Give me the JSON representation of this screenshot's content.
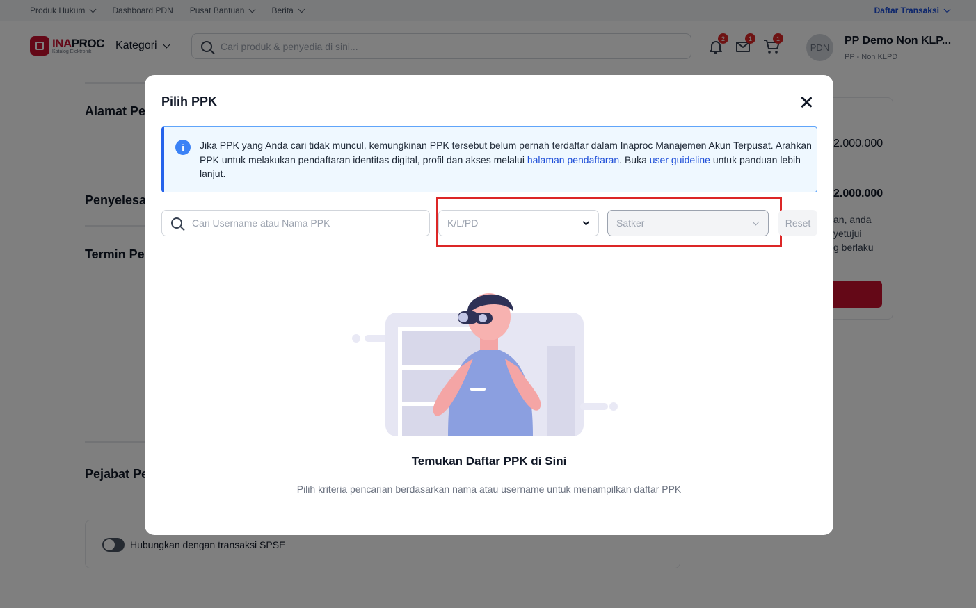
{
  "topbar": {
    "items": [
      "Produk Hukum",
      "Dashboard PDN",
      "Pusat Bantuan",
      "Berita"
    ],
    "daftar_transaksi": "Daftar Transaksi"
  },
  "header": {
    "logo_brand_a": "INA",
    "logo_brand_b": "PROC",
    "logo_tagline": "Katalog Elektronik",
    "kategori": "Kategori",
    "search_placeholder": "Cari produk & penyedia di sini...",
    "notification_count": "2",
    "message_count": "1",
    "cart_count": "1",
    "avatar_initials": "PDN",
    "user_name": "PP Demo Non KLP...",
    "user_role": "PP - Non KLPD"
  },
  "background": {
    "sections": [
      "Alamat Pe",
      "Penyelesa",
      "Termin Pe",
      "Pejabat Pe"
    ],
    "price_1": "2.000.000",
    "price_2": "2.000.000",
    "note_lines": [
      "an, anda",
      "yetujui",
      "g berlaku"
    ],
    "spse_label": "Hubungkan dengan transaksi SPSE"
  },
  "modal": {
    "title": "Pilih PPK",
    "info_part1": "Jika PPK yang Anda cari tidak muncul, kemungkinan PPK tersebut belum pernah terdaftar dalam Inaproc Manajemen Akun Terpusat. Arahkan PPK untuk melakukan pendaftaran identitas digital, profil dan akses melalui ",
    "info_link1": "halaman pendaftaran",
    "info_part2": ". Buka ",
    "info_link2": "user guideline",
    "info_part3": " untuk panduan lebih lanjut.",
    "search_placeholder": "Cari Username atau Nama PPK",
    "select_klpd": "K/L/PD",
    "select_satker": "Satker",
    "reset_label": "Reset",
    "empty_title": "Temukan Daftar PPK di Sini",
    "empty_desc": "Pilih kriteria pencarian berdasarkan nama atau username untuk menampilkan daftar PPK"
  },
  "colors": {
    "brand_red": "#c8102e",
    "link_blue": "#1d4ed8",
    "highlight_red": "#dc2626"
  }
}
